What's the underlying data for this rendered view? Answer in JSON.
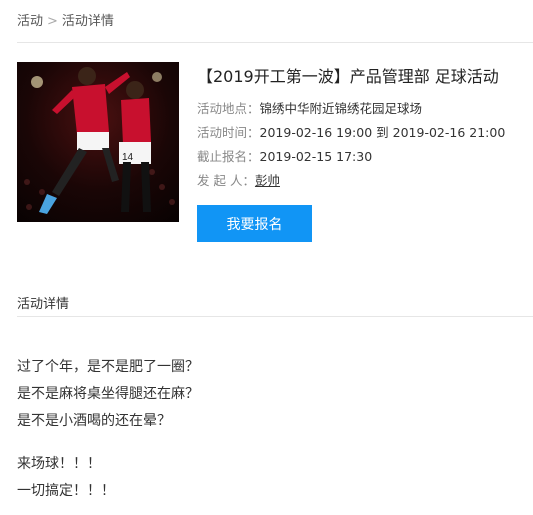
{
  "breadcrumb": {
    "home": "活动",
    "separator": ">",
    "current": "活动详情"
  },
  "event": {
    "title": "【2019开工第一波】产品管理部 足球活动",
    "location_label": "活动地点：",
    "location": "锦绣中华附近锦绣花园足球场",
    "time_label": "活动时间：",
    "time_start": "2019-02-16 19:00",
    "time_to": "到",
    "time_end": "2019-02-16 21:00",
    "deadline_label": "截止报名：",
    "deadline": "2019-02-15 17:30",
    "organizer_label": "发 起 人：",
    "organizer": "彭帅",
    "signup_button": "我要报名"
  },
  "details": {
    "section_title": "活动详情",
    "lines": [
      "过了个年，是不是肥了一圈？",
      "是不是麻将桌坐得腿还在麻？",
      "是不是小酒喝的还在晕？",
      "来场球！！！",
      "一切搞定！！！"
    ]
  },
  "colors": {
    "accent": "#1195f5",
    "divider": "#e6e6e6",
    "label": "#888888"
  }
}
